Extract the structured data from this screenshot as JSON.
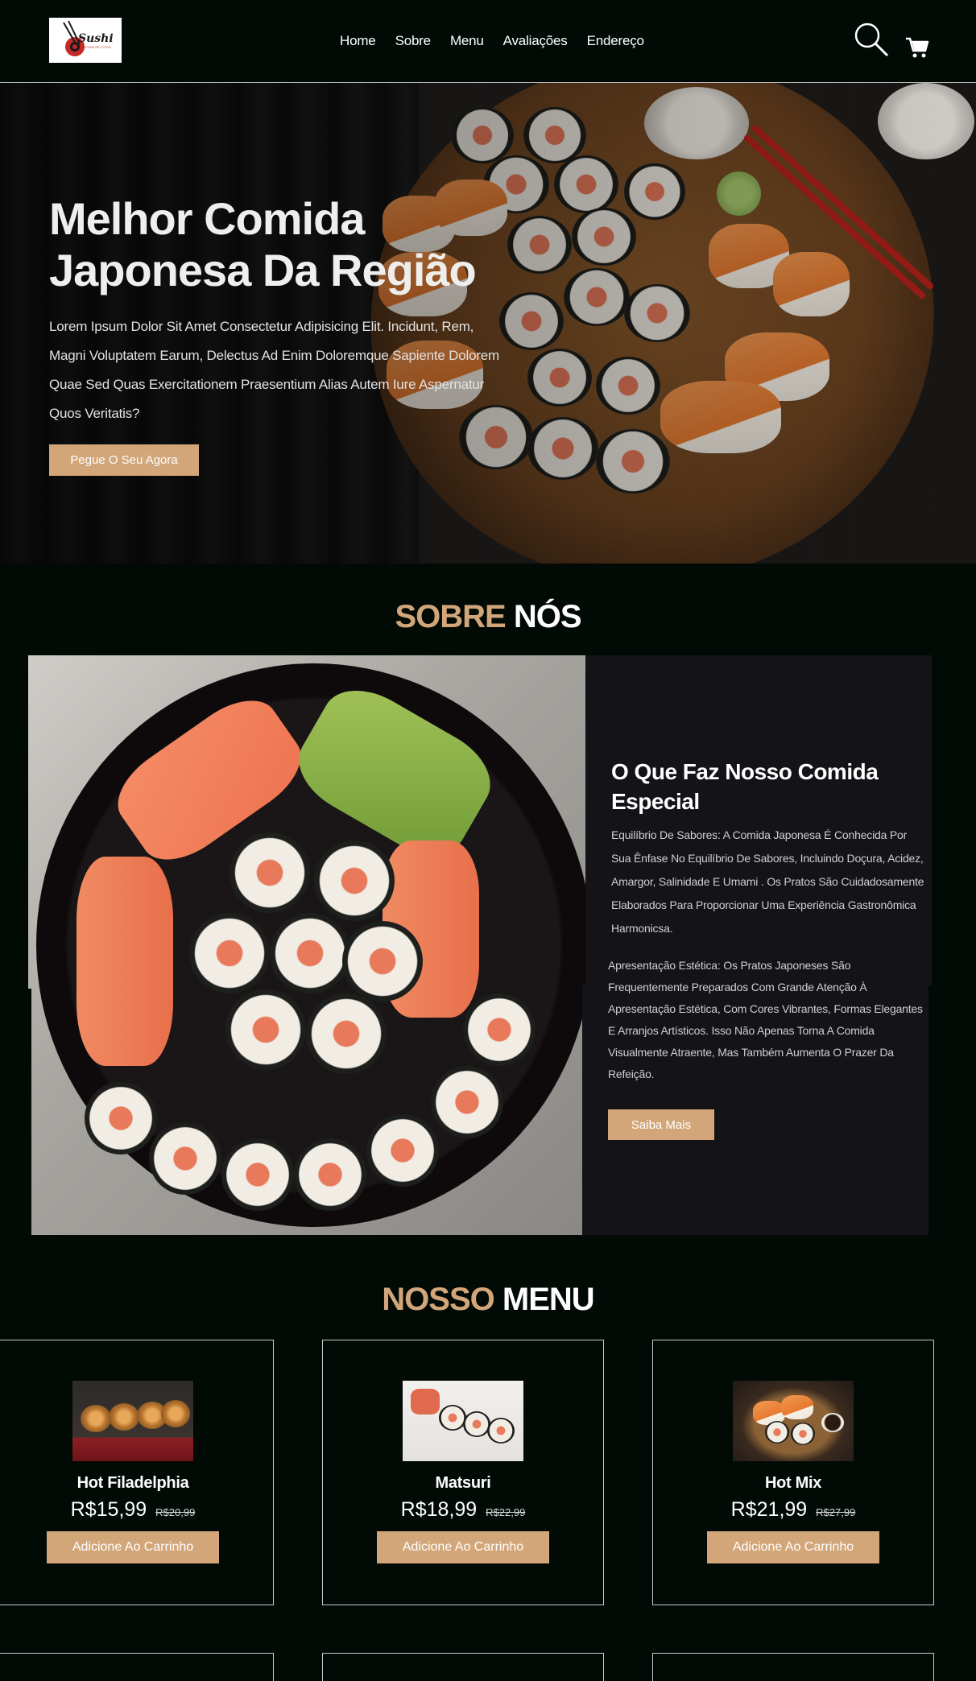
{
  "brand": {
    "logo_text": "Sushi",
    "logo_sub": "JAPANESE FOOD"
  },
  "nav": [
    {
      "label": "Home"
    },
    {
      "label": "Sobre"
    },
    {
      "label": "Menu"
    },
    {
      "label": "Avaliações"
    },
    {
      "label": "Endereço"
    }
  ],
  "hero": {
    "title": "Melhor Comida Japonesa Da Região",
    "text": "Lorem Ipsum Dolor Sit Amet Consectetur Adipisicing Elit. Incidunt, Rem, Magni Voluptatem Earum, Delectus Ad Enim Doloremque Sapiente Dolorem Quae Sed Quas Exercitationem Praesentium Alias Autem Iure Aspernatur Quos Veritatis?",
    "button": "Pegue O Seu Agora"
  },
  "about": {
    "title_a": "SOBRE",
    "title_b": "NÓS",
    "heading": "O Que Faz Nosso Comida Especial",
    "p1": "Equilíbrio De Sabores: A Comida Japonesa É Conhecida Por Sua Ênfase No Equilíbrio De Sabores, Incluindo Doçura, Acidez, Amargor, Salinidade E Umami . Os Pratos São Cuidadosamente Elaborados Para Proporcionar Uma Experiência Gastronômica Harmonicsa.",
    "p2": "Apresentação Estética: Os Pratos Japoneses São Frequentemente Preparados Com Grande Atenção À Apresentação Estética, Com Cores Vibrantes, Formas Elegantes E Arranjos Artísticos. Isso Não Apenas Torna A Comida Visualmente Atraente, Mas Também Aumenta O Prazer Da Refeição.",
    "button": "Saiba Mais"
  },
  "menu": {
    "title_a": "NOSSO",
    "title_b": "MENU",
    "items": [
      {
        "name": "Hot Filadelphia",
        "price": "R$15,99",
        "old_price": "R$20,99",
        "button": "Adicione Ao Carrinho"
      },
      {
        "name": "Matsuri",
        "price": "R$18,99",
        "old_price": "R$22,99",
        "button": "Adicione Ao Carrinho"
      },
      {
        "name": "Hot Mix",
        "price": "R$21,99",
        "old_price": "R$27,99",
        "button": "Adicione Ao Carrinho"
      }
    ]
  },
  "colors": {
    "background": "#010a05",
    "accent": "#d2a679",
    "card": "#131318"
  }
}
